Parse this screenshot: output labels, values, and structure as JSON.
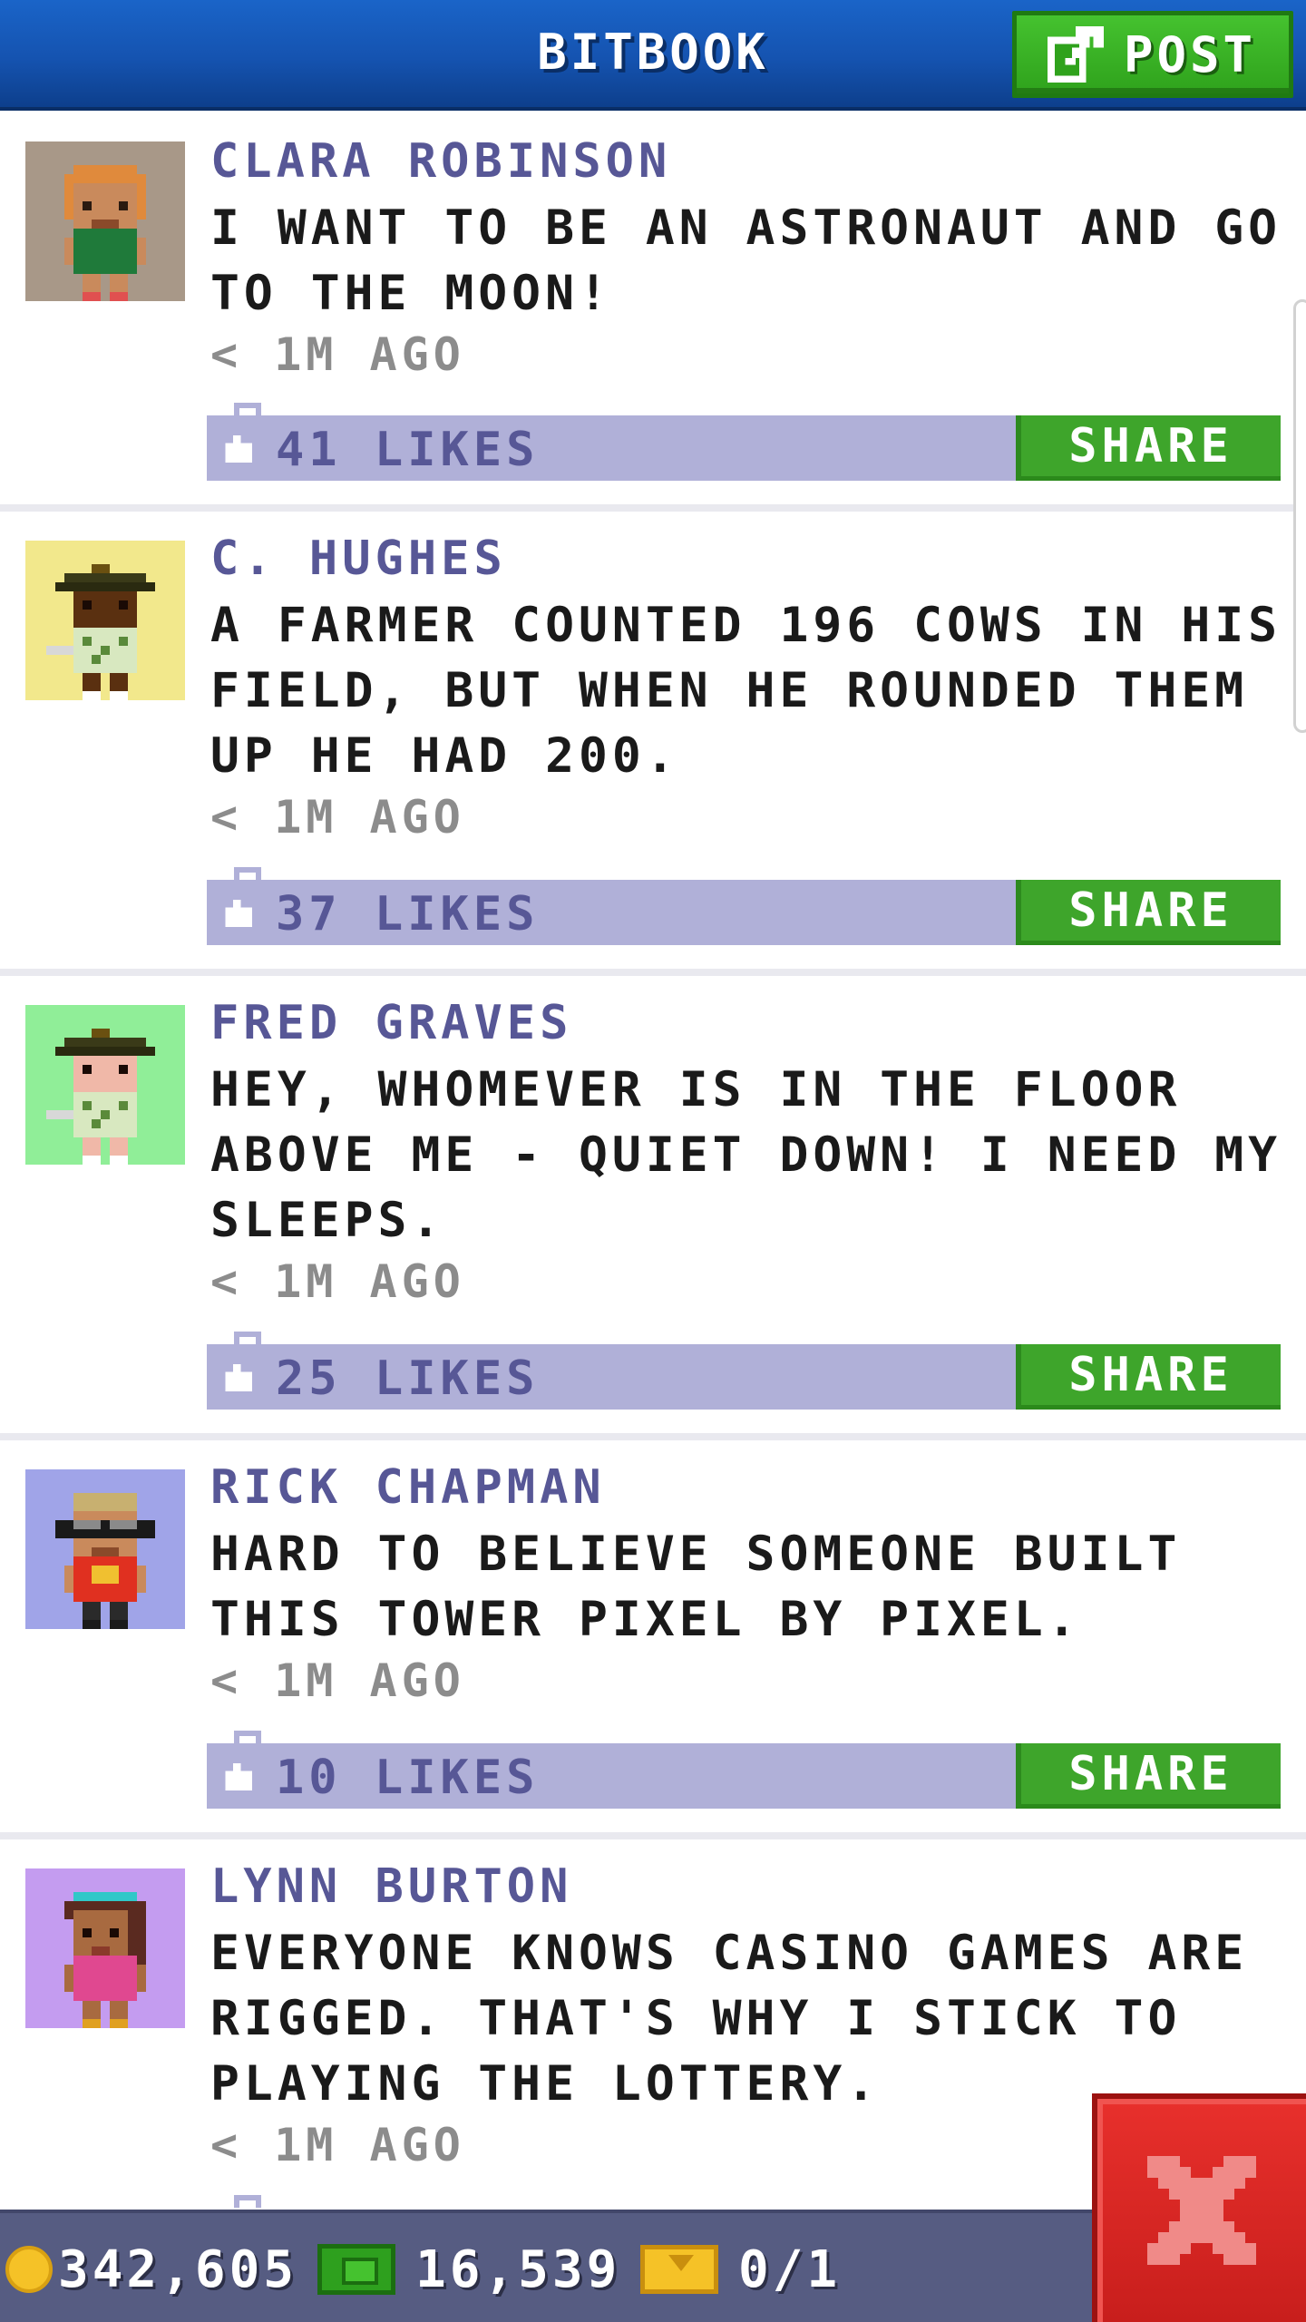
{
  "header": {
    "title": "BITBOOK",
    "post_label": "POST"
  },
  "posts": [
    {
      "author": "CLARA ROBINSON",
      "message": "I WANT TO BE AN ASTRONAUT AND GO TO THE MOON!",
      "time": "< 1M AGO",
      "likes": "41 LIKES",
      "share": "SHARE",
      "avatar_bg": "#a89888",
      "avatar_icon": "girl-green-dress-avatar"
    },
    {
      "author": "C. HUGHES",
      "message": "A FARMER COUNTED 196 COWS IN HIS FIELD, BUT WHEN HE ROUNDED THEM UP HE HAD 200.",
      "time": "< 1M AGO",
      "likes": "37 LIKES",
      "share": "SHARE",
      "avatar_bg": "#f2e88c",
      "avatar_icon": "golfer-dark-avatar"
    },
    {
      "author": "FRED GRAVES",
      "message": "HEY, WHOMEVER IS IN THE FLOOR ABOVE ME - QUIET DOWN! I NEED MY SLEEPS.",
      "time": "< 1M AGO",
      "likes": "25 LIKES",
      "share": "SHARE",
      "avatar_bg": "#90ee98",
      "avatar_icon": "golfer-light-avatar"
    },
    {
      "author": "RICK CHAPMAN",
      "message": "HARD TO BELIEVE SOMEONE BUILT THIS TOWER PIXEL BY PIXEL.",
      "time": "< 1M AGO",
      "likes": "10 LIKES",
      "share": "SHARE",
      "avatar_bg": "#a0a4e8",
      "avatar_icon": "sunglasses-man-avatar"
    },
    {
      "author": "LYNN BURTON",
      "message": "EVERYONE KNOWS CASINO GAMES ARE RIGGED. THAT'S WHY I STICK TO PLAYING THE LOTTERY.",
      "time": "< 1M AGO",
      "avatar_bg": "#c49cf0",
      "avatar_icon": "woman-pink-dress-avatar"
    }
  ],
  "footer": {
    "coins": "342,605",
    "cash": "16,539",
    "tickets": "0/1"
  },
  "colors": {
    "header_blue": "#1553b0",
    "post_green": "#2fa21c",
    "share_green": "#3ea52b",
    "like_bar": "#b0b0d8",
    "author_text": "#575796",
    "close_red": "#c81e1c",
    "footer_bg": "#565c82"
  }
}
